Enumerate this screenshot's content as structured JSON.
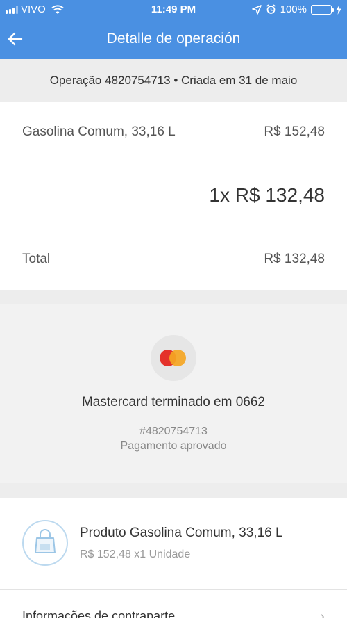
{
  "status_bar": {
    "carrier": "VIVO",
    "time": "11:49 PM",
    "battery": "100%",
    "icons": [
      "signal-icon",
      "wifi-icon",
      "location-icon",
      "alarm-icon",
      "battery-icon",
      "charging-icon"
    ]
  },
  "header": {
    "title": "Detalle de operación",
    "back_icon": "arrow-left-icon"
  },
  "operation_bar": {
    "text": "Operação 4820754713 • Criada em 31 de maio"
  },
  "summary": {
    "item_label": "Gasolina Comum, 33,16 L",
    "item_price": "R$ 152,48",
    "installment": "1x R$ 132,48",
    "total_label": "Total",
    "total_value": "R$ 132,48"
  },
  "payment": {
    "icon": "mastercard-icon",
    "method": "Mastercard terminado em 0662",
    "id": "#4820754713",
    "status": "Pagamento aprovado"
  },
  "product": {
    "icon": "shopping-bag-icon",
    "title": "Produto Gasolina Comum, 33,16 L",
    "subtitle": "R$ 152,48 x1 Unidade"
  },
  "info_row": {
    "label": "Informações de contraparte"
  },
  "colors": {
    "header_blue": "#4a90e2",
    "mastercard_red": "#e4322b",
    "mastercard_orange": "#f5a623",
    "battery_green": "#5ed65e"
  }
}
